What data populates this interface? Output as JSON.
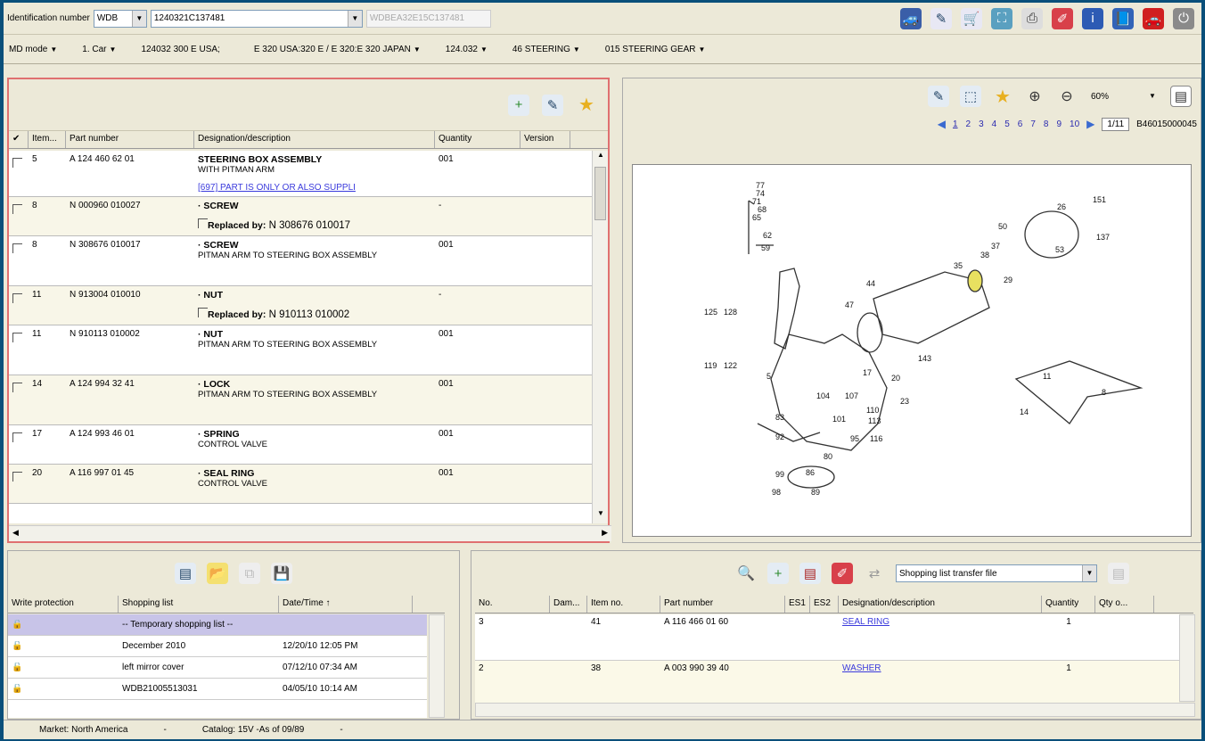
{
  "ident": {
    "label": "Identification number",
    "prefix": "WDB",
    "number": "1240321C137481",
    "vin": "WDBEA32E15C137481"
  },
  "breadcrumb": [
    "MD mode",
    "1. Car",
    "124032 300 E USA;",
    "E 320 USA:320 E / E 320:E 320 JAPAN",
    "124.032",
    "46 STEERING",
    "015 STEERING GEAR"
  ],
  "parts": {
    "columns": [
      "✔",
      "Item...",
      "Part number",
      "Designation/description",
      "Quantity",
      "Version"
    ],
    "rows": [
      {
        "item": "5",
        "part": "A 124 460 62 01",
        "name": "STEERING BOX ASSEMBLY",
        "sub": "WITH PITMAN ARM",
        "link": "[697] PART IS ONLY OR ALSO SUPPLI",
        "qty": "001",
        "alt": false
      },
      {
        "item": "8",
        "part": "N 000960 010027",
        "name": "· SCREW",
        "repl_label": "Replaced by:",
        "repl": "N 308676 010017",
        "qty": "-",
        "alt": true
      },
      {
        "item": "8",
        "part": "N 308676 010017",
        "name": "· SCREW",
        "sub": "PITMAN ARM TO STEERING BOX ASSEMBLY",
        "qty": "001",
        "alt": false
      },
      {
        "item": "11",
        "part": "N 913004 010010",
        "name": "· NUT",
        "repl_label": "Replaced by:",
        "repl": "N 910113 010002",
        "qty": "-",
        "alt": true
      },
      {
        "item": "11",
        "part": "N 910113 010002",
        "name": "· NUT",
        "sub": "PITMAN ARM TO STEERING BOX ASSEMBLY",
        "qty": "001",
        "alt": false
      },
      {
        "item": "14",
        "part": "A 124 994 32 41",
        "name": "· LOCK",
        "sub": "PITMAN ARM TO STEERING BOX ASSEMBLY",
        "qty": "001",
        "alt": true
      },
      {
        "item": "17",
        "part": "A 124 993 46 01",
        "name": "· SPRING",
        "sub": "CONTROL VALVE",
        "qty": "001",
        "alt": false
      },
      {
        "item": "20",
        "part": "A 116 997 01 45",
        "name": "· SEAL RING",
        "sub": "CONTROL VALVE",
        "qty": "001",
        "alt": true
      }
    ]
  },
  "viewer": {
    "zoom": "60%",
    "pages": [
      "1",
      "2",
      "3",
      "4",
      "5",
      "6",
      "7",
      "8",
      "9",
      "10"
    ],
    "page_box": "1/11",
    "drawing_id": "B46015000045"
  },
  "diagram_labels": [
    "77",
    "74",
    "71",
    "68",
    "65",
    "62",
    "59",
    "125",
    "128",
    "119",
    "122",
    "5",
    "47",
    "44",
    "35",
    "38",
    "37",
    "29",
    "50",
    "26",
    "151",
    "137",
    "53",
    "143",
    "17",
    "20",
    "23",
    "104",
    "107",
    "110",
    "113",
    "101",
    "83",
    "92",
    "95",
    "116",
    "80",
    "99",
    "86",
    "98",
    "89",
    "11",
    "8",
    "14"
  ],
  "shopping": {
    "columns": [
      "Write protection",
      "Shopping list",
      "Date/Time ↑"
    ],
    "rows": [
      {
        "name": "-- Temporary shopping list --",
        "date": "",
        "sel": true
      },
      {
        "name": "December 2010",
        "date": "12/20/10 12:05 PM"
      },
      {
        "name": "left mirror cover",
        "date": "07/12/10 07:34 AM"
      },
      {
        "name": "WDB21005513031",
        "date": "04/05/10 10:14 AM"
      }
    ]
  },
  "transfer": {
    "select": "Shopping list transfer file",
    "columns": [
      "No.",
      "Dam...",
      "Item no.",
      "Part number",
      "ES1",
      "ES2",
      "Designation/description",
      "Quantity",
      "Qty o..."
    ],
    "rows": [
      {
        "no": "3",
        "item": "41",
        "part": "A 116 466 01 60",
        "desc": "SEAL RING",
        "qty": "1"
      },
      {
        "no": "2",
        "item": "38",
        "part": "A 003 990 39 40",
        "desc": "WASHER",
        "qty": "1"
      }
    ]
  },
  "status": {
    "market": "Market: North America",
    "dash": "-",
    "catalog": "Catalog: 15V -As of 09/89",
    "dash2": "-"
  }
}
